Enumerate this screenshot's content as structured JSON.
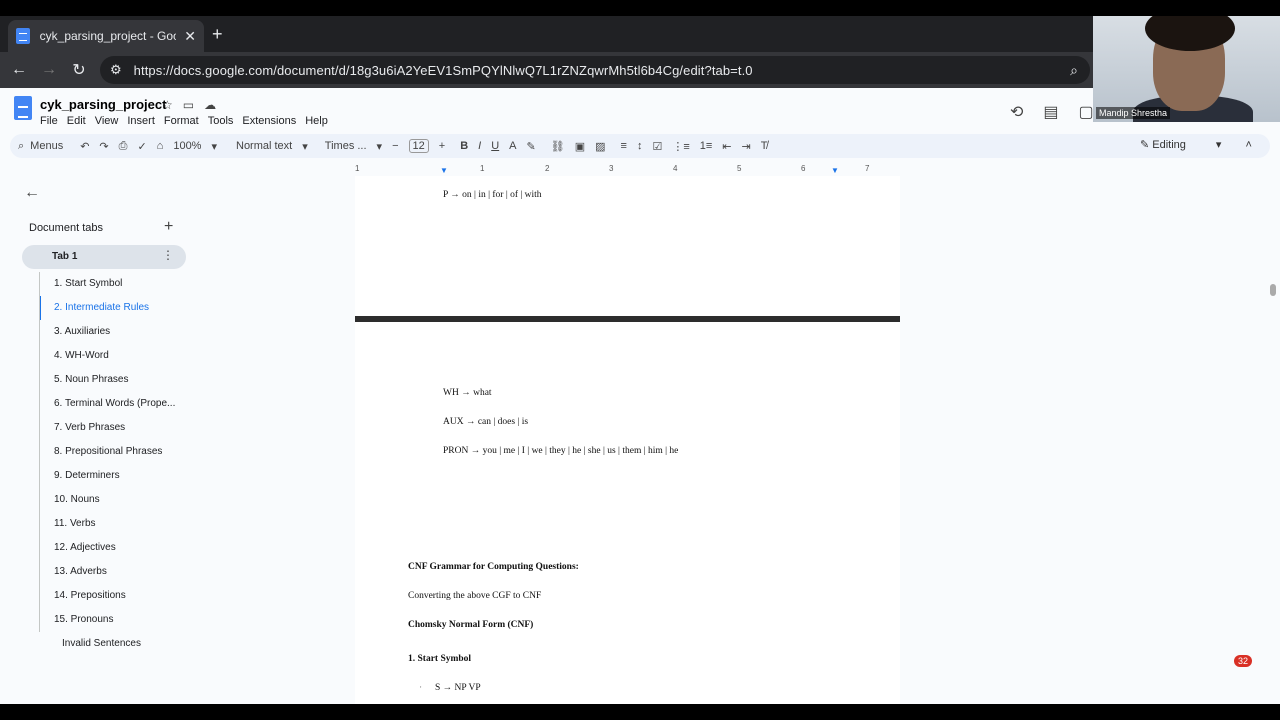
{
  "browser": {
    "tab_title": "cyk_parsing_project - Google D",
    "url": "https://docs.google.com/document/d/18g3u6iA2YeEV1SmPQYlNlwQ7L1rZNZqwrMh5tl6b4Cg/edit?tab=t.0"
  },
  "docs": {
    "title": "cyk_parsing_project",
    "menu": [
      "File",
      "Edit",
      "View",
      "Insert",
      "Format",
      "Tools",
      "Extensions",
      "Help"
    ],
    "toolbar": {
      "menus_label": "Menus",
      "zoom": "100%",
      "style": "Normal text",
      "font": "Times ...",
      "font_size": "12",
      "mode": "Editing"
    }
  },
  "webcam": {
    "name": "Mandip Shrestha"
  },
  "ruler": [
    "1",
    "1",
    "2",
    "3",
    "4",
    "5",
    "6",
    "7"
  ],
  "sidebar": {
    "heading": "Document tabs",
    "tab": "Tab 1",
    "outline": [
      "1. Start Symbol",
      "2. Intermediate Rules",
      "3. Auxiliaries",
      "4. WH-Word",
      "5. Noun Phrases",
      "6. Terminal Words (Prope...",
      "7. Verb Phrases",
      "8. Prepositional Phrases",
      "9. Determiners",
      "10. Nouns",
      "11. Verbs",
      "12. Adjectives",
      "13. Adverbs",
      "14. Prepositions",
      "15. Pronouns",
      "Invalid Sentences"
    ]
  },
  "document": {
    "p_rule": "P → on | in | for | of | with",
    "wh_rule": "WH → what",
    "aux_rule": "AUX → can | does | is",
    "pron_rule": "PRON → you | me | I | we | they | he | she | us | them | him | he",
    "cnf_heading": "CNF Grammar for Computing Questions:",
    "converting": "Converting the above CGF to CNF",
    "chomsky": "Chomsky Normal Form (CNF)",
    "start_symbol": "1. Start Symbol",
    "s_rule": "S → NP VP",
    "bullet": "·"
  },
  "notification_count": "32"
}
